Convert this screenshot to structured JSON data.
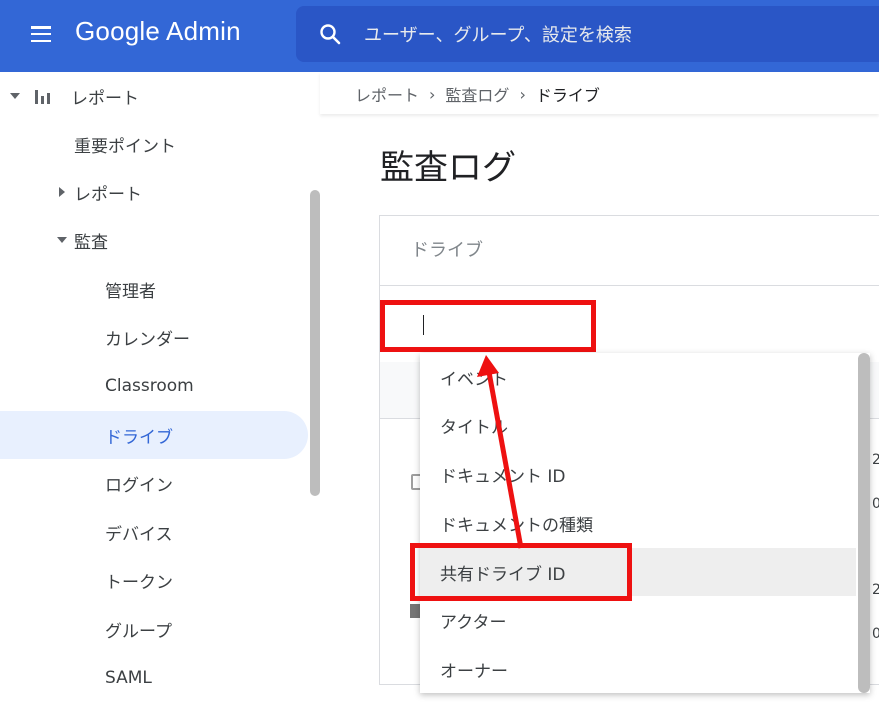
{
  "header": {
    "app_title": "Google Admin",
    "search_placeholder": "ユーザー、グループ、設定を検索"
  },
  "sidebar": {
    "items": [
      {
        "label": "レポート"
      },
      {
        "label": "重要ポイント"
      },
      {
        "label": "レポート"
      },
      {
        "label": "監査"
      },
      {
        "label": "管理者"
      },
      {
        "label": "カレンダー"
      },
      {
        "label": "Classroom"
      },
      {
        "label": "ドライブ"
      },
      {
        "label": "ログイン"
      },
      {
        "label": "デバイス"
      },
      {
        "label": "トークン"
      },
      {
        "label": "グループ"
      },
      {
        "label": "SAML"
      }
    ],
    "selected": "ドライブ"
  },
  "breadcrumb": {
    "items": [
      "レポート",
      "監査ログ",
      "ドライブ"
    ],
    "separator": "›"
  },
  "main": {
    "page_title": "監査ログ",
    "card_title": "ドライブ",
    "filter_value": "",
    "right_digits": [
      "2",
      "0",
      "2",
      "0"
    ]
  },
  "dropdown": {
    "options": [
      "イベント",
      "タイトル",
      "ドキュメント ID",
      "ドキュメントの種類",
      "共有ドライブ ID",
      "アクター",
      "オーナー"
    ],
    "highlighted": "共有ドライブ ID"
  },
  "colors": {
    "header_bg": "#3367d6",
    "search_bg": "#2a56c6",
    "active_bg": "#e8f0fe",
    "annotation": "#ee1111"
  }
}
